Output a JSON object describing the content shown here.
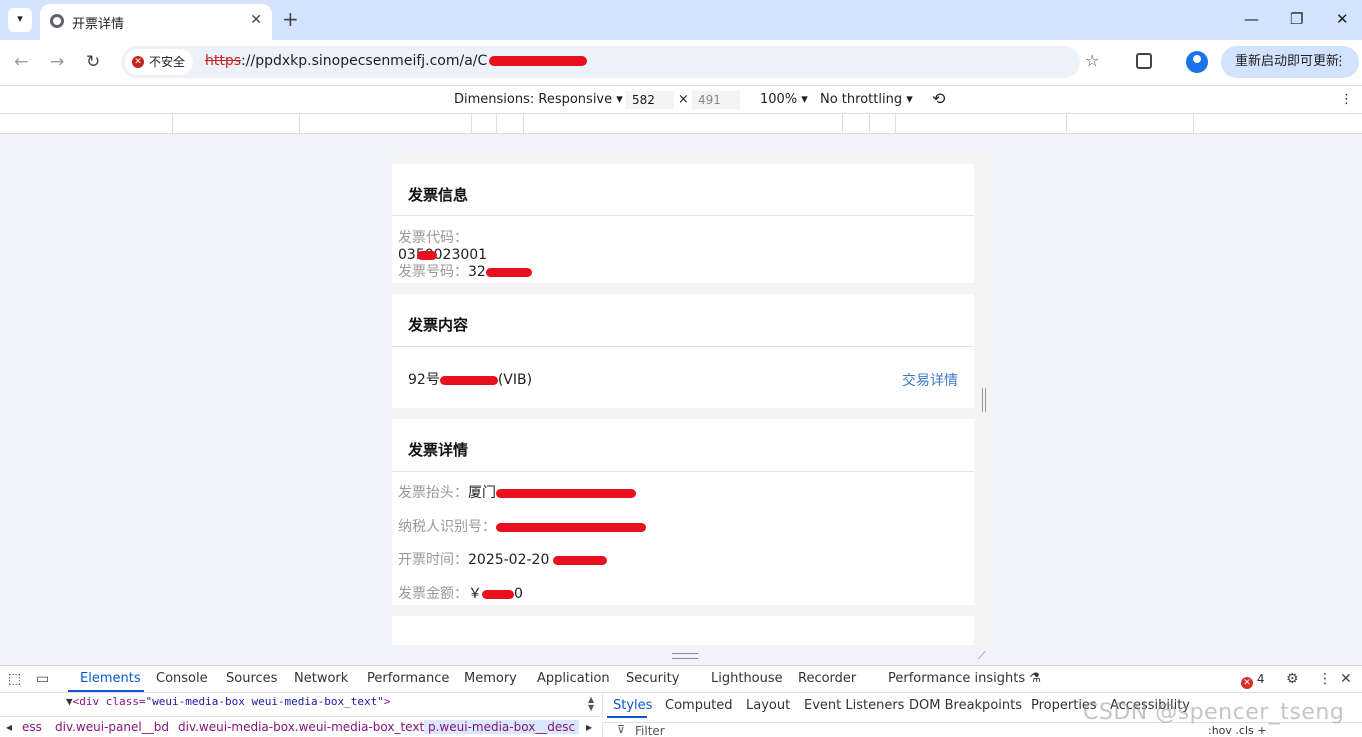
{
  "tab": {
    "title": "开票详情",
    "close": "✕",
    "new": "+"
  },
  "window": {
    "minimize": "—",
    "restore": "❐",
    "close": "✕"
  },
  "address": {
    "security_label": "不安全",
    "url_scheme": "https",
    "url_rest": "://ppdxkp.sinopecsenmeifj.com/a/C"
  },
  "update_button": {
    "label": "重新启动即可更新",
    "menu": "⋮"
  },
  "device_toolbar": {
    "dimensions_label": "Dimensions: Responsive ▾",
    "width": "582",
    "times": "×",
    "height": "491",
    "zoom": "100% ▾",
    "throttling": "No throttling ▾",
    "menu": "⋮"
  },
  "invoice": {
    "info": {
      "heading": "发票信息",
      "code_label": "发票代码：",
      "code_value": "0350023001",
      "number_label": "发票号码：",
      "number_value": "32"
    },
    "content": {
      "heading": "发票内容",
      "product": "92号",
      "product_suffix": "(VIB)",
      "detail_link": "交易详情"
    },
    "details": {
      "heading": "发票详情",
      "title_label": "发票抬头：",
      "title_value": "厦门",
      "tax_label": "纳税人识别号：",
      "tax_value": "",
      "time_label": "开票时间：",
      "time_value": "2025-02-20",
      "amount_label": "发票金额：",
      "amount_value": "￥",
      "amount_tail": "0"
    }
  },
  "devtools": {
    "tabs": [
      "Elements",
      "Console",
      "Sources",
      "Network",
      "Performance",
      "Memory",
      "Application",
      "Security",
      "Lighthouse",
      "Recorder",
      "Performance insights ⚗"
    ],
    "error_count": "4",
    "code_open": "<div class=",
    "code_class": "\"weui-media-box weui-media-box_text\"",
    "code_close": ">",
    "breadcrumbs": [
      "ess",
      "div.weui-panel__bd",
      "div.weui-media-box.weui-media-box_text",
      "p.weui-media-box__desc"
    ],
    "styles_tabs": [
      "Styles",
      "Computed",
      "Layout",
      "Event Listeners",
      "DOM Breakpoints",
      "Properties",
      "Accessibility"
    ],
    "filter_placeholder": "Filter",
    "filter_right": ":hov  .cls  +"
  },
  "watermark": "CSDN @spencer_tseng"
}
